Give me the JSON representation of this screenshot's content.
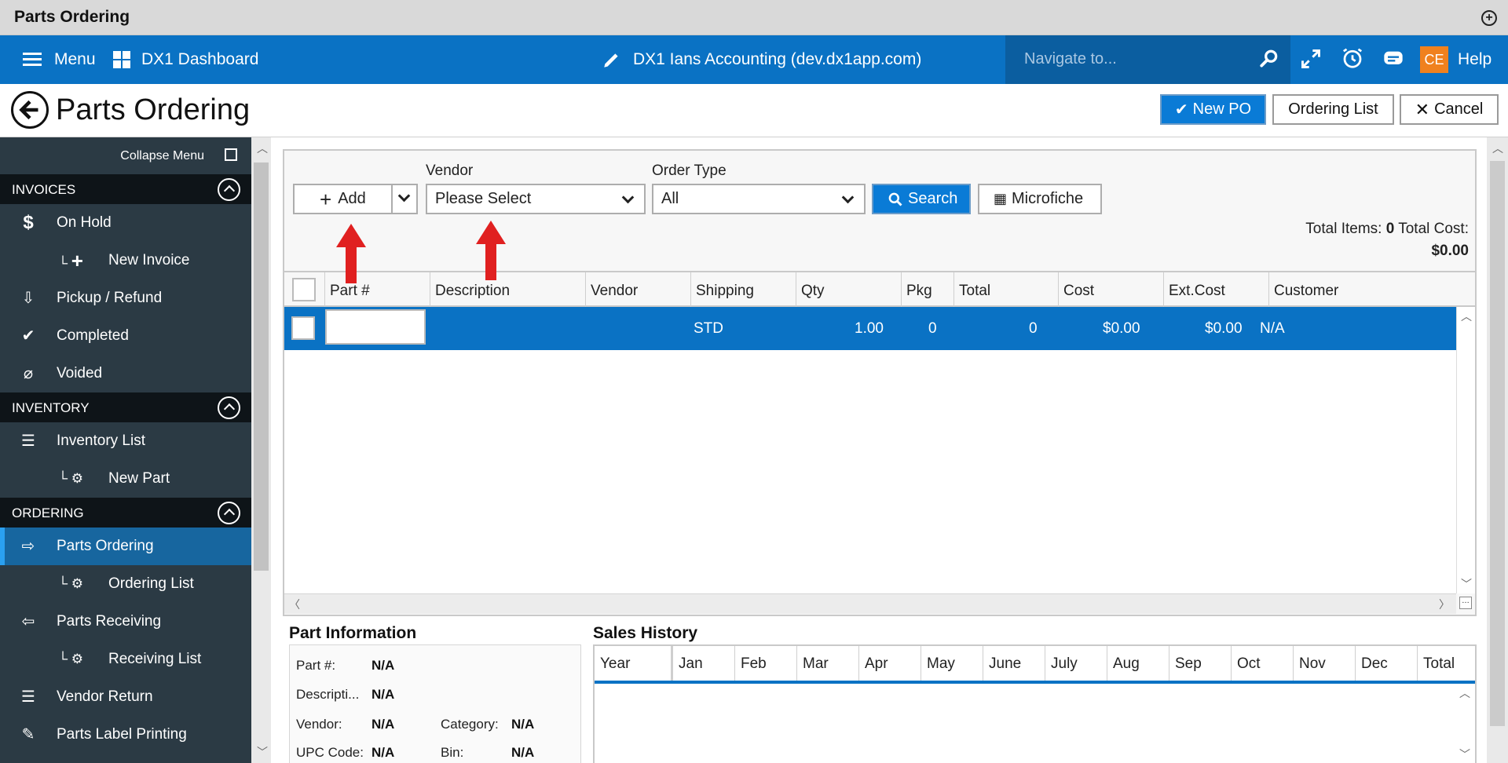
{
  "window": {
    "title": "Parts Ordering"
  },
  "appbar": {
    "menu_label": "Menu",
    "dashboard_label": "DX1 Dashboard",
    "account_label": "DX1 Ians Accounting (dev.dx1app.com)",
    "navigate_placeholder": "Navigate to...",
    "user_initials": "CE",
    "help_label": "Help"
  },
  "page": {
    "title": "Parts Ordering",
    "new_po_label": "New PO",
    "ordering_list_label": "Ordering List",
    "cancel_label": "Cancel"
  },
  "sidebar": {
    "collapse_label": "Collapse Menu",
    "sections": {
      "invoices": "INVOICES",
      "inventory": "INVENTORY",
      "ordering": "ORDERING"
    },
    "items": {
      "on_hold": "On Hold",
      "new_invoice": "New Invoice",
      "pickup_refund": "Pickup / Refund",
      "completed": "Completed",
      "voided": "Voided",
      "inventory_list": "Inventory List",
      "new_part": "New Part",
      "parts_ordering": "Parts Ordering",
      "ordering_list": "Ordering List",
      "parts_receiving": "Parts Receiving",
      "receiving_list": "Receiving List",
      "vendor_return": "Vendor Return",
      "parts_label_printing": "Parts Label Printing"
    }
  },
  "toolbar": {
    "add_label": "Add",
    "vendor_label": "Vendor",
    "vendor_value": "Please Select",
    "order_type_label": "Order Type",
    "order_type_value": "All",
    "search_label": "Search",
    "microfiche_label": "Microfiche",
    "total_items_label": "Total Items:",
    "total_items_value": "0",
    "total_cost_label": "Total Cost:",
    "total_cost_value": "$0.00"
  },
  "grid": {
    "columns": {
      "part": "Part #",
      "description": "Description",
      "vendor": "Vendor",
      "shipping": "Shipping",
      "qty": "Qty",
      "pkg": "Pkg",
      "total": "Total",
      "cost": "Cost",
      "extcost": "Ext.Cost",
      "customer": "Customer"
    },
    "row": {
      "part": "",
      "shipping": "STD",
      "qty": "1.00",
      "pkg": "0",
      "total": "0",
      "cost": "$0.00",
      "extcost": "$0.00",
      "customer": "N/A"
    }
  },
  "part_info": {
    "title": "Part Information",
    "part_label": "Part #:",
    "part_value": "N/A",
    "description_label": "Descripti...",
    "description_value": "N/A",
    "vendor_label": "Vendor:",
    "vendor_value": "N/A",
    "category_label": "Category:",
    "category_value": "N/A",
    "upc_label": "UPC Code:",
    "upc_value": "N/A",
    "bin_label": "Bin:",
    "bin_value": "N/A"
  },
  "sales_history": {
    "title": "Sales History",
    "columns": [
      "Year",
      "Jan",
      "Feb",
      "Mar",
      "Apr",
      "May",
      "June",
      "July",
      "Aug",
      "Sep",
      "Oct",
      "Nov",
      "Dec",
      "Total"
    ]
  },
  "colors": {
    "brand_blue": "#0a72c4",
    "sidebar_bg": "#2b3a44",
    "accent_orange": "#f0811e",
    "annotation_red": "#e02020"
  }
}
